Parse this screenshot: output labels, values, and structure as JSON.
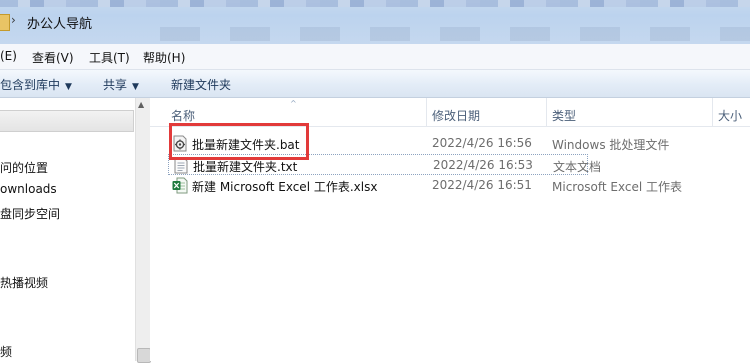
{
  "window": {
    "title": "办公人导航",
    "address_separator": "›"
  },
  "menu": [
    {
      "label": "编辑(E)",
      "visible": "(E)"
    },
    {
      "label": "查看(V)"
    },
    {
      "label": "工具(T)"
    },
    {
      "label": "帮助(H)"
    }
  ],
  "menu_labels": {
    "edit": "(E)",
    "view": "查看(V)",
    "tools": "工具(T)",
    "help": "帮助(H)"
  },
  "toolbar": {
    "include_library": "包含到库中",
    "share": "共享",
    "new_folder": "新建文件夹",
    "dropdown_glyph": "▼"
  },
  "nav": {
    "items": [
      "问的位置",
      "ownloads",
      "盘同步空间",
      "热播视频",
      "频"
    ]
  },
  "columns": {
    "name": "名称",
    "date": "修改日期",
    "type": "类型",
    "size": "大小",
    "sort_glyph": "^"
  },
  "files": [
    {
      "name": "批量新建文件夹.bat",
      "date": "2022/4/26 16:56",
      "type": "Windows 批处理文件",
      "icon": "bat-gear-icon"
    },
    {
      "name": "批量新建文件夹.txt",
      "date": "2022/4/26 16:53",
      "type": "文本文档",
      "icon": "text-file-icon"
    },
    {
      "name": "新建 Microsoft Excel 工作表.xlsx",
      "date": "2022/4/26 16:51",
      "type": "Microsoft Excel 工作表",
      "icon": "excel-file-icon"
    }
  ],
  "colors": {
    "highlight": "#e23a3a",
    "toolbar_text": "#1e395b",
    "header_text": "#4c607a"
  }
}
